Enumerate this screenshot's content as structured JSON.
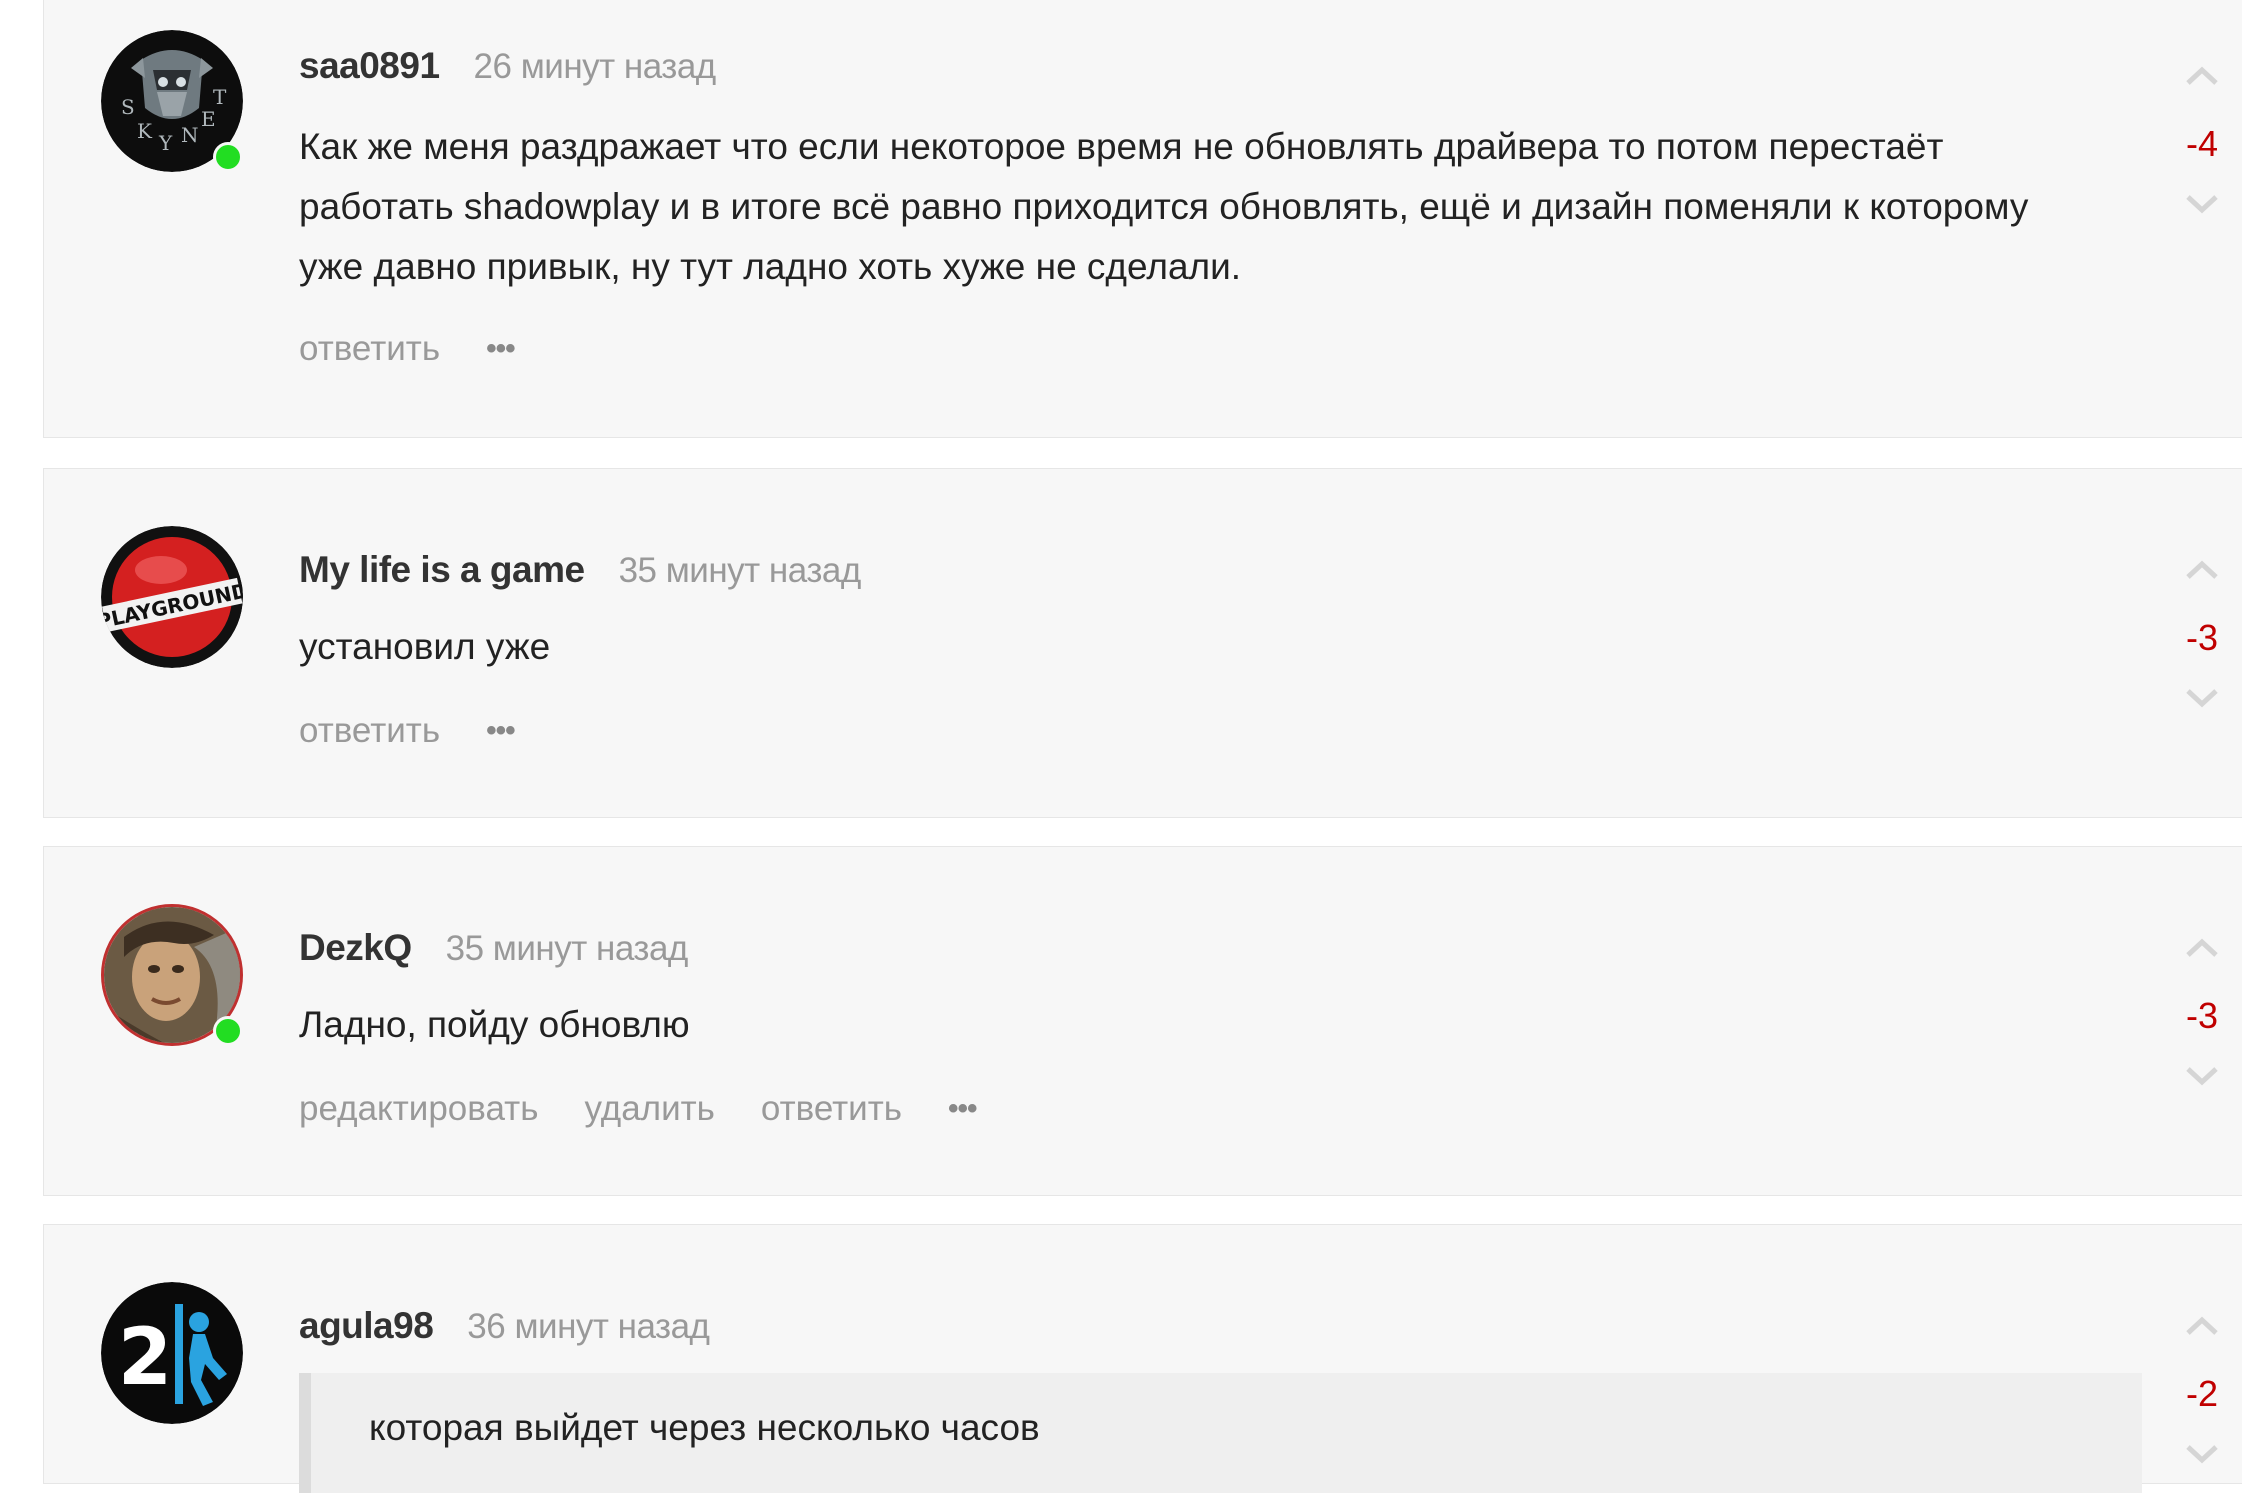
{
  "comments": [
    {
      "author": "saa0891",
      "time": "26 минут назад",
      "text": "Как же меня раздражает что если некоторое время не обновлять драйвера то потом перестаёт работать shadowplay и в итоге всё равно приходится обновлять, ещё и дизайн поменяли к которому уже давно привык, ну тут ладно хоть хуже не сделали.",
      "score": "-4",
      "online": true,
      "avatar_icon": "skynet-helmet-avatar",
      "avatar_text": "SKYNET",
      "actions": [
        "ответить"
      ]
    },
    {
      "author": "My life is a game",
      "time": "35 минут назад",
      "text": "установил уже",
      "score": "-3",
      "online": false,
      "avatar_icon": "playground-ball-avatar",
      "avatar_text": "PLAYGROUND",
      "actions": [
        "ответить"
      ]
    },
    {
      "author": "DezkQ",
      "time": "35 минут назад",
      "text": "Ладно, пойду обновлю",
      "score": "-3",
      "online": true,
      "avatar_icon": "portrait-avatar",
      "actions": [
        "редактировать",
        "удалить",
        "ответить"
      ]
    },
    {
      "author": "agula98",
      "time": "36 минут назад",
      "quote": "которая выйдет через несколько часов",
      "score": "-2",
      "online": false,
      "avatar_icon": "portal-2-avatar",
      "avatar_text": "2"
    }
  ],
  "more_label": "•••",
  "colors": {
    "card_bg": "#f7f7f7",
    "negative_score": "#c00000",
    "online": "#22dd22",
    "muted_text": "#999999"
  }
}
